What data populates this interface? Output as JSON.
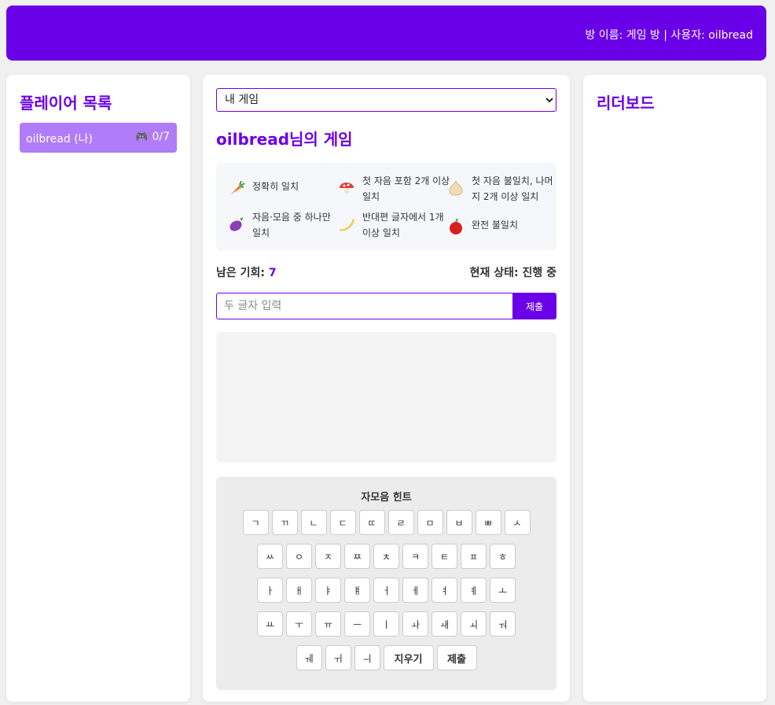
{
  "header": {
    "info": "방 이름: 게임 방 | 사용자: oilbread"
  },
  "players": {
    "title": "플레이어 목록",
    "items": [
      {
        "name": "oilbread (나)",
        "icon": "🎮",
        "score": "0/7"
      }
    ]
  },
  "game": {
    "select_value": "내 게임",
    "title": "oilbread님의 게임",
    "legend": [
      {
        "icon": "carrot-icon",
        "color": "#f07c1f",
        "text": "정확히 일치"
      },
      {
        "icon": "mushroom-icon",
        "color": "#e23b3b",
        "text": "첫 자음 포함 2개 이상 일치"
      },
      {
        "icon": "garlic-icon",
        "color": "#f0dcb8",
        "text": "첫 자음 불일치, 나머지 2개 이상 일치"
      },
      {
        "icon": "eggplant-icon",
        "color": "#8a3fb5",
        "text": "자음·모음 중 하나만 일치"
      },
      {
        "icon": "banana-icon",
        "color": "#f5c842",
        "text": "반대편 글자에서 1개 이상 일치"
      },
      {
        "icon": "apple-icon",
        "color": "#d62020",
        "text": "완전 불일치"
      }
    ],
    "remaining_label": "남은 기회:",
    "remaining_value": "7",
    "status_label": "현재 상태:",
    "status_value": "진행 중",
    "input_placeholder": "두 글자 입력",
    "submit_label": "제출"
  },
  "keyboard": {
    "title": "자모음 힌트",
    "rows": [
      [
        "ㄱ",
        "ㄲ",
        "ㄴ",
        "ㄷ",
        "ㄸ",
        "ㄹ",
        "ㅁ",
        "ㅂ",
        "ㅃ",
        "ㅅ"
      ],
      [
        "ㅆ",
        "ㅇ",
        "ㅈ",
        "ㅉ",
        "ㅊ",
        "ㅋ",
        "ㅌ",
        "ㅍ",
        "ㅎ"
      ],
      [
        "ㅏ",
        "ㅐ",
        "ㅑ",
        "ㅒ",
        "ㅓ",
        "ㅔ",
        "ㅕ",
        "ㅖ",
        "ㅗ"
      ],
      [
        "ㅛ",
        "ㅜ",
        "ㅠ",
        "ㅡ",
        "ㅣ",
        "ㅘ",
        "ㅙ",
        "ㅚ",
        "ㅝ"
      ],
      [
        "ㅞ",
        "ㅟ",
        "ㅢ"
      ]
    ],
    "erase_label": "지우기",
    "submit_label": "제출"
  },
  "leaderboard": {
    "title": "리더보드"
  }
}
